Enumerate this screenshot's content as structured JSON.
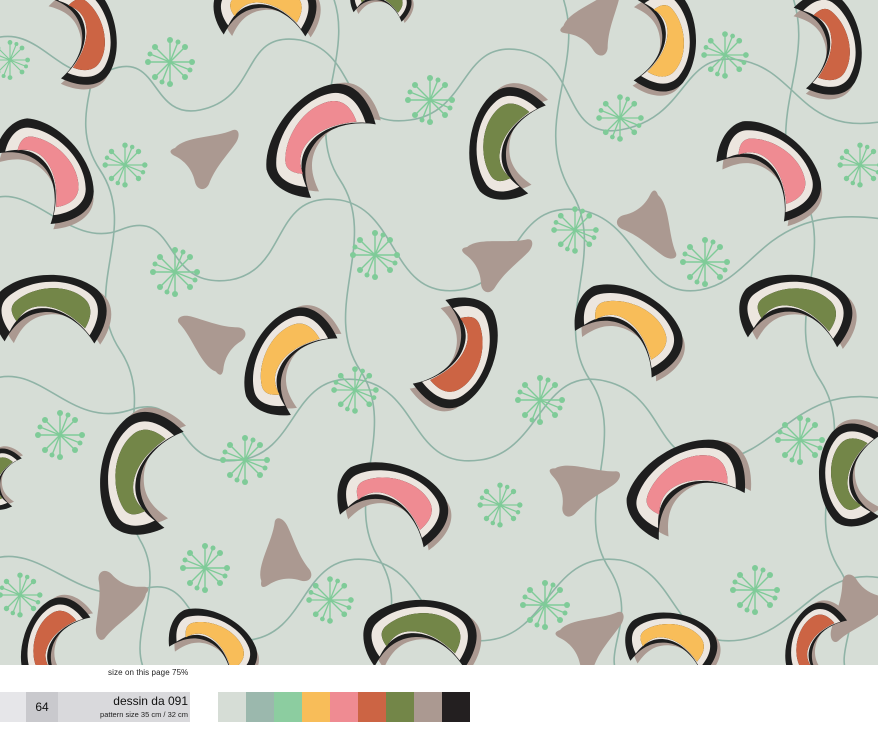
{
  "caption": {
    "size_note": "size on this page 75%",
    "page_number": "64",
    "title": "dessin da 091",
    "pattern_size": "pattern size 35 cm / 32 cm"
  },
  "palette": [
    {
      "name": "pale-grey-green",
      "color": "#d6ddd6"
    },
    {
      "name": "grey-teal",
      "color": "#9bb8ad"
    },
    {
      "name": "mint-green",
      "color": "#8ccda0"
    },
    {
      "name": "golden-yellow",
      "color": "#f8bd59"
    },
    {
      "name": "coral-pink",
      "color": "#ef8b92"
    },
    {
      "name": "burnt-orange",
      "color": "#cc6444"
    },
    {
      "name": "olive-green",
      "color": "#738648"
    },
    {
      "name": "taupe",
      "color": "#ab9991"
    },
    {
      "name": "black",
      "color": "#231f20"
    }
  ],
  "pattern_colors": {
    "background": "#d6ddd6",
    "vine": "#8fb3a6",
    "burst": "#7fcb98",
    "taupe": "#ab9991",
    "black": "#1e1e1e",
    "cream": "#ece6df",
    "pink": "#ef8b92",
    "olive": "#738648",
    "yellow": "#f8bd59",
    "orange": "#cc6444"
  }
}
